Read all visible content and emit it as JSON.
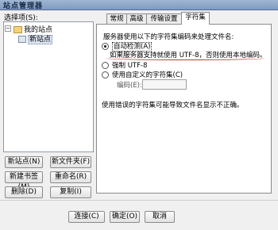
{
  "window": {
    "title": "站点管理器"
  },
  "left": {
    "select_label": "选择项(S):",
    "tree": {
      "root": "我的站点",
      "child": "新站点"
    },
    "buttons": {
      "new_site": "新站点(N)",
      "new_folder": "新文件夹(F)",
      "new_bookmark": "新建书签(M)",
      "rename": "重命名(R)",
      "delete": "删除(D)",
      "copy": "复制(I)"
    }
  },
  "tabs": [
    "常规",
    "高级",
    "传输设置",
    "字符集"
  ],
  "active_tab": "字符集",
  "charset": {
    "heading": "服务器使用以下的字符集编码来处理文件名:",
    "auto_detect": "自动检测(A)",
    "auto_note": "如果服务器支持就使用 UTF-8，否则使用本地编码。",
    "force_utf8": "强制 UTF-8",
    "custom": "使用自定义的字符集(C)",
    "encoding_label": "编码(E):",
    "encoding_value": "",
    "warning": "使用错误的字符集可能导致文件名显示不正确。",
    "selected_option": "auto_detect"
  },
  "footer": {
    "connect": "连接(C)",
    "ok": "确定(O)",
    "cancel": "取消"
  }
}
